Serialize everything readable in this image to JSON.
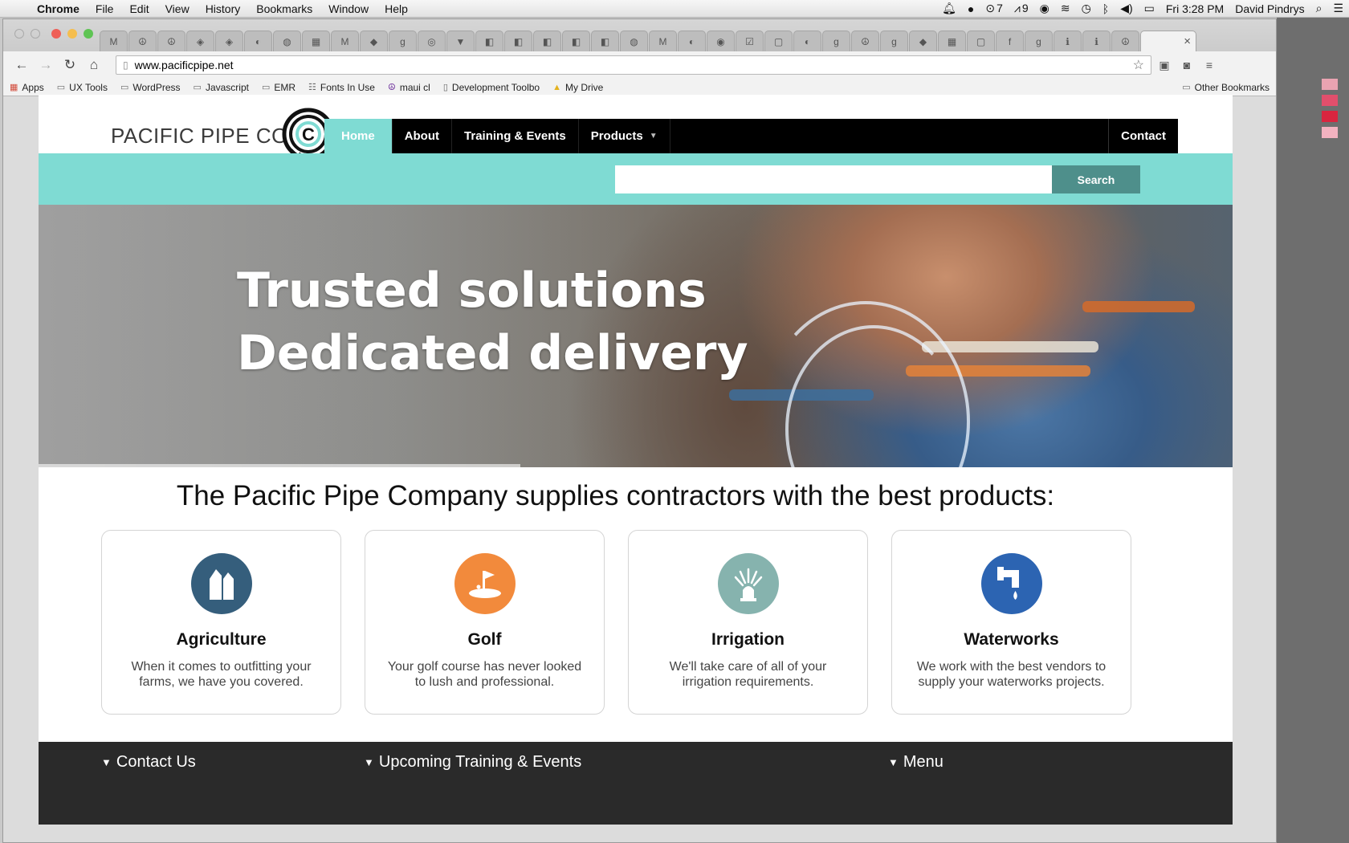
{
  "os_menu": {
    "app": "Chrome",
    "items": [
      "File",
      "Edit",
      "View",
      "History",
      "Bookmarks",
      "Window",
      "Help"
    ],
    "status": {
      "badge_a": "7",
      "badge_b": "9",
      "clock": "Fri 3:28 PM",
      "user": "David Pindrys"
    }
  },
  "browser": {
    "url": "www.pacificpipe.net",
    "tab_close": "×",
    "bookmarks": [
      "Apps",
      "UX Tools",
      "WordPress",
      "Javascript",
      "EMR",
      "Fonts In Use",
      "maui cl",
      "Development Toolbo",
      "My Drive"
    ],
    "other_bookmarks": "Other Bookmarks",
    "clipped_left": "Ap",
    "clipped_right": "arks"
  },
  "site": {
    "logo_text": "PACIFIC PIPE CO.",
    "nav": {
      "home": "Home",
      "about": "About",
      "training": "Training & Events",
      "products": "Products",
      "contact": "Contact"
    },
    "search": {
      "placeholder": "",
      "button": "Search"
    },
    "hero": {
      "line1": "Trusted solutions",
      "line2": "Dedicated delivery"
    },
    "tagline": "The Pacific Pipe Company supplies contractors with the best products:",
    "cards": [
      {
        "title": "Agriculture",
        "desc": "When it comes to outfitting your farms, we have you covered.",
        "icon": "silo-icon",
        "color": "#355e7c"
      },
      {
        "title": "Golf",
        "desc": "Your golf course has never looked to lush and professional.",
        "icon": "golf-flag-icon",
        "color": "#f28a3c"
      },
      {
        "title": "Irrigation",
        "desc": "We'll take care of all of your irrigation requirements.",
        "icon": "sprinkler-icon",
        "color": "#86b3ae"
      },
      {
        "title": "Waterworks",
        "desc": "We work with the best vendors to supply your waterworks projects.",
        "icon": "faucet-icon",
        "color": "#2c64b2"
      }
    ],
    "footer": {
      "contact": "Contact Us",
      "events": "Upcoming Training & Events",
      "menu": "Menu"
    }
  },
  "colors": {
    "accent_teal": "#7fdbd3",
    "search_button": "#4e8f8b",
    "nav_bg": "#000000",
    "footer_bg": "#2a2a2a"
  }
}
